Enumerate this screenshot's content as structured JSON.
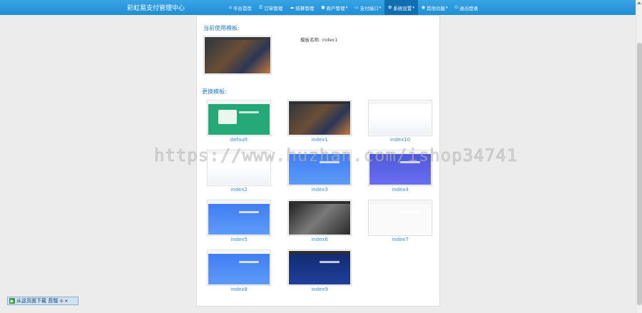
{
  "header": {
    "brand": "彩虹易支付管理中心",
    "nav": [
      {
        "icon": "home-icon",
        "glyph": "⌂",
        "label": "平台首页",
        "caret": false,
        "active": false
      },
      {
        "icon": "list-icon",
        "glyph": "☰",
        "label": "订单管理",
        "caret": false,
        "active": false
      },
      {
        "icon": "cloud-icon",
        "glyph": "☁",
        "label": "结算管理",
        "caret": false,
        "active": false
      },
      {
        "icon": "user-icon",
        "glyph": "●",
        "label": "商户管理",
        "caret": true,
        "active": false
      },
      {
        "icon": "card-icon",
        "glyph": "▭",
        "label": "支付接口",
        "caret": true,
        "active": false
      },
      {
        "icon": "gear-icon",
        "glyph": "✿",
        "label": "系统设置",
        "caret": true,
        "active": true
      },
      {
        "icon": "globe-icon",
        "glyph": "◉",
        "label": "其他功能",
        "caret": true,
        "active": false
      },
      {
        "icon": "power-icon",
        "glyph": "⏻",
        "label": "退出登录",
        "caret": false,
        "active": false
      }
    ]
  },
  "current": {
    "title": "当前使用模板:",
    "name_label": "模板名称:",
    "name_value": "index1"
  },
  "change": {
    "title": "更换模板:",
    "templates": [
      {
        "name": "default",
        "style": "green"
      },
      {
        "name": "index1",
        "style": "dark"
      },
      {
        "name": "index10",
        "style": "light"
      },
      {
        "name": "index2",
        "style": "light"
      },
      {
        "name": "index3",
        "style": "blue"
      },
      {
        "name": "index4",
        "style": "purple"
      },
      {
        "name": "index5",
        "style": "blue"
      },
      {
        "name": "index6",
        "style": "bw"
      },
      {
        "name": "index7",
        "style": "white"
      },
      {
        "name": "index8",
        "style": "blue"
      },
      {
        "name": "index9",
        "style": "navy"
      }
    ]
  },
  "watermark": "https://www.huzhan.com/ishop34741",
  "download_bar": {
    "label": "从这页面下载 吾瓢",
    "extra": "② ✕"
  }
}
